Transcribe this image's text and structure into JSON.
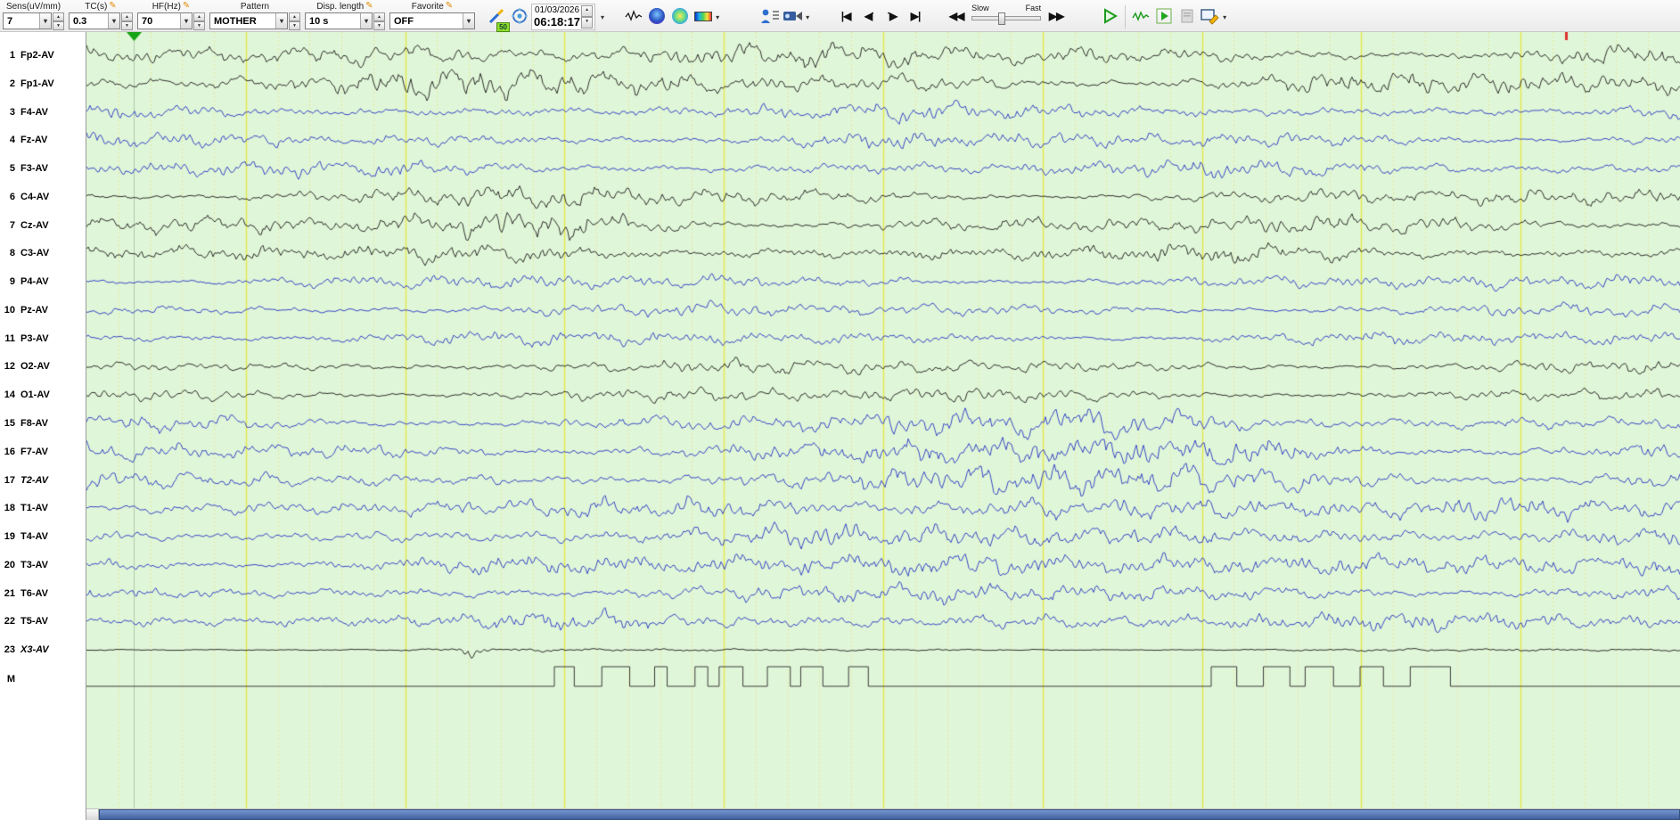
{
  "toolbar": {
    "sens": {
      "label": "Sens(uV/mm)",
      "value": "7"
    },
    "tc": {
      "label": "TC(s)",
      "value": "0.3"
    },
    "hf": {
      "label": "HF(Hz)",
      "value": "70"
    },
    "pattern": {
      "label": "Pattern",
      "value": "MOTHER"
    },
    "disp": {
      "label": "Disp. length",
      "value": "10 s"
    },
    "favorite": {
      "label": "Favorite",
      "value": "OFF"
    },
    "filter_badge": "50",
    "date": "01/03/2026",
    "time": "06:18:17",
    "speed_slow": "Slow",
    "speed_fast": "Fast",
    "nav": {
      "first": "|◀",
      "prev": "◀",
      "next": "▶",
      "last": "▶|",
      "rewind": "◀◀",
      "forward": "▶▶",
      "play": "▶"
    }
  },
  "event_channel": {
    "label": "M"
  },
  "colors": {
    "trace_black": "#1b1b1b",
    "trace_blue": "#2636c4",
    "background_green": "#e0f6d8",
    "grid_solid": "#e7e74a",
    "grid_dotted": "#e4e490",
    "marker_green": "#17a317",
    "event_red": "#e03131",
    "scrollbar_blue": "#41619f"
  },
  "channels": [
    {
      "num": "1",
      "label": "Fp2-AV",
      "color": "#1b1b1b",
      "amp": 11,
      "burst": [
        350,
        220,
        0.35
      ]
    },
    {
      "num": "2",
      "label": "Fp1-AV",
      "color": "#1b1b1b",
      "amp": 11,
      "burst": [
        350,
        220,
        0.35
      ]
    },
    {
      "num": "3",
      "label": "F4-AV",
      "color": "#2636c4",
      "amp": 8
    },
    {
      "num": "4",
      "label": "Fz-AV",
      "color": "#2636c4",
      "amp": 8
    },
    {
      "num": "5",
      "label": "F3-AV",
      "color": "#2636c4",
      "amp": 8
    },
    {
      "num": "6",
      "label": "C4-AV",
      "color": "#1b1b1b",
      "amp": 8,
      "burst": [
        515,
        130,
        0.5
      ]
    },
    {
      "num": "7",
      "label": "Cz-AV",
      "color": "#1b1b1b",
      "amp": 9,
      "burst": [
        515,
        120,
        0.9
      ]
    },
    {
      "num": "8",
      "label": "C3-AV",
      "color": "#1b1b1b",
      "amp": 8,
      "burst": [
        515,
        130,
        0.5
      ]
    },
    {
      "num": "9",
      "label": "P4-AV",
      "color": "#2636c4",
      "amp": 7
    },
    {
      "num": "10",
      "label": "Pz-AV",
      "color": "#2636c4",
      "amp": 7
    },
    {
      "num": "11",
      "label": "P3-AV",
      "color": "#2636c4",
      "amp": 7
    },
    {
      "num": "12",
      "label": "O2-AV",
      "color": "#1b1b1b",
      "amp": 7
    },
    {
      "num": "14",
      "label": "O1-AV",
      "color": "#1b1b1b",
      "amp": 7
    },
    {
      "num": "15",
      "label": "F8-AV",
      "color": "#2636c4",
      "amp": 9,
      "burst": [
        1160,
        250,
        0.7
      ]
    },
    {
      "num": "16",
      "label": "F7-AV",
      "color": "#2636c4",
      "amp": 10,
      "burst": [
        1160,
        250,
        0.7
      ]
    },
    {
      "num": "17",
      "label": "T2-AV",
      "color": "#2636c4",
      "amp": 10,
      "burst": [
        1160,
        250,
        0.7
      ],
      "italic": true
    },
    {
      "num": "18",
      "label": "T1-AV",
      "color": "#2636c4",
      "amp": 10,
      "burst": [
        1160,
        250,
        0.7
      ]
    },
    {
      "num": "19",
      "label": "T4-AV",
      "color": "#2636c4",
      "amp": 9,
      "burst": [
        1160,
        250,
        0.7
      ]
    },
    {
      "num": "20",
      "label": "T3-AV",
      "color": "#2636c4",
      "amp": 10,
      "burst": [
        1160,
        250,
        0.7
      ]
    },
    {
      "num": "21",
      "label": "T6-AV",
      "color": "#2636c4",
      "amp": 8,
      "burst": [
        1160,
        250,
        0.4
      ]
    },
    {
      "num": "22",
      "label": "T5-AV",
      "color": "#2636c4",
      "amp": 8,
      "burst": [
        1160,
        250,
        0.4
      ]
    },
    {
      "num": "23",
      "label": "X3-AV",
      "color": "#1b1b1b",
      "amp": 1.4,
      "burst": [
        430,
        12,
        5
      ],
      "italic": true
    }
  ],
  "display": {
    "seconds": 10
  }
}
